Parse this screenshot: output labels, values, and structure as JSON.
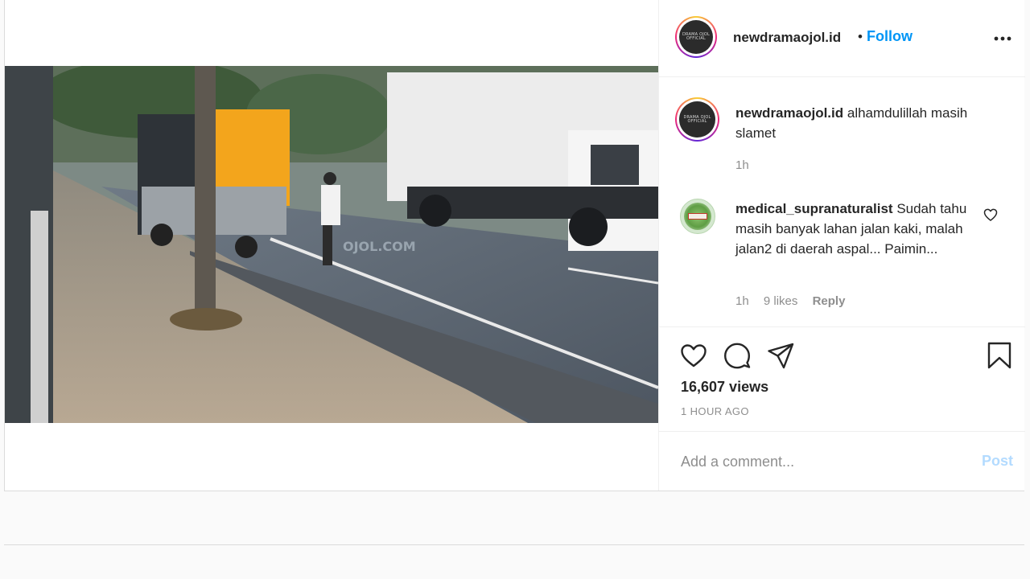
{
  "post": {
    "username": "newdramaojol.id",
    "separator": "•",
    "follow_label": "Follow",
    "avatar_text": "DRAMA OJOL\nOFFICIAL\nINDONESIA",
    "more_icon": "more-horizontal-icon",
    "video_watermark": "OJOL.COM"
  },
  "caption": {
    "username": "newdramaojol.id",
    "text": "alhamdulillah masih slamet",
    "time": "1h"
  },
  "comments": [
    {
      "username": "medical_supranaturalist",
      "text": "Sudah tahu masih banyak lahan jalan kaki, malah jalan2 di daerah aspal... Paimin...",
      "time": "1h",
      "likes": "9 likes",
      "reply_label": "Reply",
      "like_icon": "heart-outline-icon"
    }
  ],
  "actions": {
    "like_icon": "heart-icon",
    "comment_icon": "comment-bubble-icon",
    "share_icon": "paper-plane-icon",
    "save_icon": "bookmark-icon",
    "views": "16,607 views",
    "time_ago": "1 HOUR AGO"
  },
  "comment_box": {
    "placeholder": "Add a comment...",
    "post_label": "Post"
  },
  "colors": {
    "link_blue": "#0095f6",
    "post_disabled": "#b3dbff",
    "muted": "#8e8e8e",
    "border": "#dbdbdb"
  }
}
